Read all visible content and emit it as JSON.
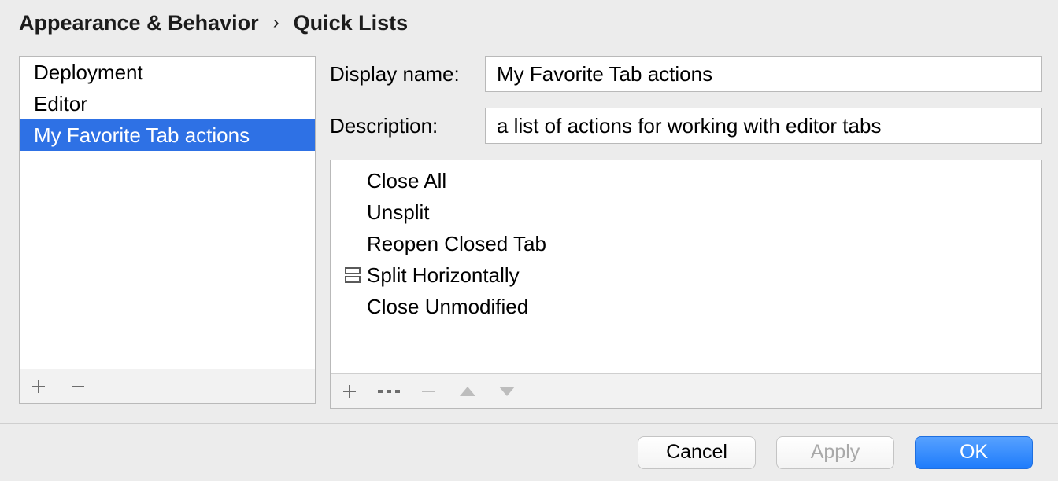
{
  "breadcrumb": {
    "parent": "Appearance & Behavior",
    "current": "Quick Lists"
  },
  "quick_lists": {
    "items": [
      {
        "label": "Deployment",
        "selected": false
      },
      {
        "label": "Editor",
        "selected": false
      },
      {
        "label": "My Favorite Tab actions",
        "selected": true
      }
    ]
  },
  "form": {
    "display_name_label": "Display name:",
    "display_name_value": "My Favorite Tab actions",
    "description_label": "Description:",
    "description_value": "a list of actions for working with editor tabs"
  },
  "actions": [
    {
      "icon": null,
      "label": "Close All"
    },
    {
      "icon": null,
      "label": "Unsplit"
    },
    {
      "icon": null,
      "label": "Reopen Closed Tab"
    },
    {
      "icon": "split-horizontal-icon",
      "label": "Split Horizontally"
    },
    {
      "icon": null,
      "label": "Close Unmodified"
    }
  ],
  "dialog_buttons": {
    "cancel": "Cancel",
    "apply": "Apply",
    "ok": "OK"
  },
  "icons": {
    "plus": "plus-icon",
    "minus": "minus-icon",
    "separator": "separator-icon",
    "up": "arrow-up-icon",
    "down": "arrow-down-icon"
  }
}
